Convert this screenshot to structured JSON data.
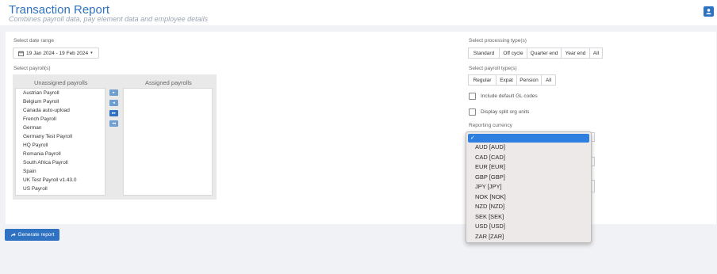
{
  "header": {
    "title": "Transaction Report",
    "subtitle": "Combines payroll data, pay element data and employee details"
  },
  "date_range": {
    "label": "Select date range",
    "value": "19 Jan 2024 - 19 Feb 2024",
    "caret": "▾"
  },
  "payrolls": {
    "label": "Select payroll(s)",
    "unassigned_title": "Unassigned payrolls",
    "assigned_title": "Assigned payrolls",
    "unassigned": [
      "Austrian Payroll",
      "Belgium Payroll",
      "Canada auto-upload",
      "French Payroll",
      "German",
      "Germany Test Payroll",
      "HQ Payroll",
      "Romania Payroll",
      "South Africa Payroll",
      "Spain",
      "UK Test Payroll v1.43.0",
      "US Payroll"
    ],
    "assigned": [],
    "buttons": {
      "move_one_right": "▸",
      "move_one_left": "◂",
      "move_all_right": "▸▸",
      "move_all_left": "◂◂"
    }
  },
  "processing_type": {
    "label": "Select processing type(s)",
    "options": [
      "Standard",
      "Off cycle",
      "Quarter end",
      "Year end",
      "All"
    ]
  },
  "payroll_type": {
    "label": "Select payroll type(s)",
    "options": [
      "Regular",
      "Expat",
      "Pension",
      "All"
    ]
  },
  "options": {
    "include_gl": "Include default GL codes",
    "split_org": "Display split org units"
  },
  "currency": {
    "label": "Reporting currency",
    "selected_mark": "✓",
    "options": [
      "AUD [AUD]",
      "CAD [CAD]",
      "EUR [EUR]",
      "GBP [GBP]",
      "JPY [JPY]",
      "NOK [NOK]",
      "NZD [NZD]",
      "SEK [SEK]",
      "USD [USD]",
      "ZAR [ZAR]"
    ]
  },
  "generate_button": "Generate report",
  "colors": {
    "accent": "#2f72c1",
    "dropdown_highlight": "#2f7fe0"
  },
  "icons": {
    "user": "user-icon",
    "calendar": "calendar-icon",
    "generate": "share-arrow-icon"
  }
}
